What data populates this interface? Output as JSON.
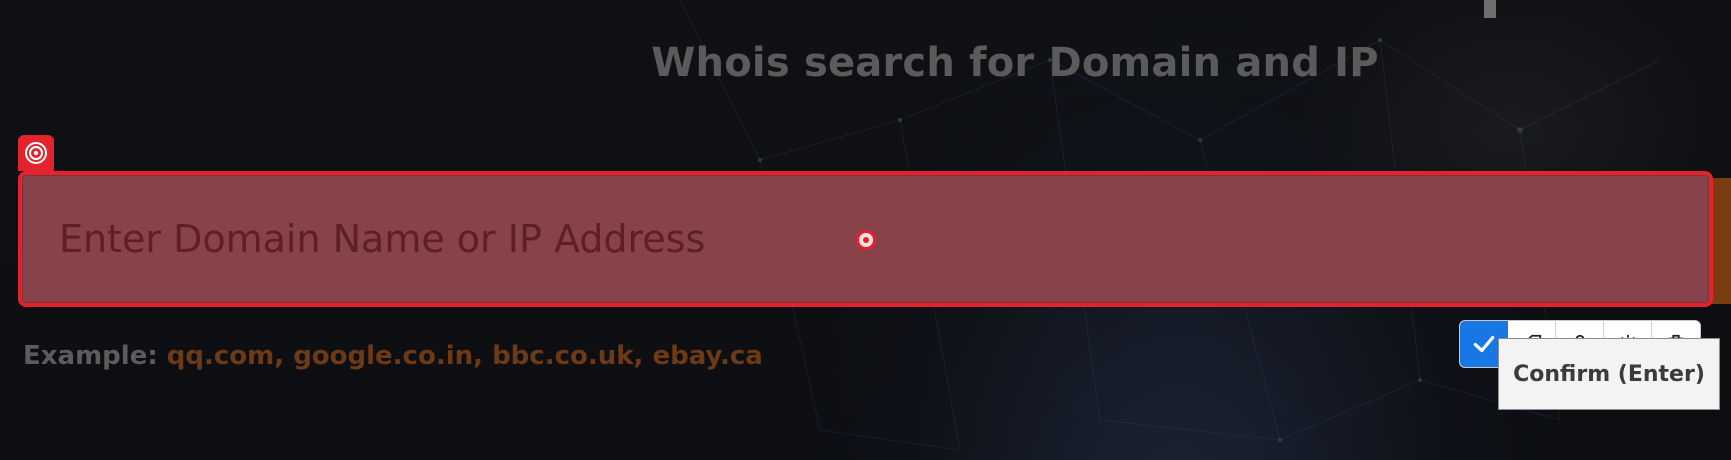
{
  "page": {
    "title": "Whois search for Domain and IP"
  },
  "search": {
    "placeholder": "Enter Domain Name or IP Address",
    "value": ""
  },
  "example": {
    "label": "Example:",
    "values": "qq.com, google.co.in, bbc.co.uk, ebay.ca"
  },
  "annotation_toolbar": {
    "buttons": [
      {
        "icon": "checkmark-icon"
      },
      {
        "icon": "tag-icon"
      },
      {
        "icon": "person-icon"
      },
      {
        "icon": "gear-icon"
      },
      {
        "icon": "trash-icon"
      }
    ],
    "tooltip": "Confirm (Enter)"
  },
  "colors": {
    "highlight": "#e3232e",
    "highlight_fill": "#874349",
    "confirm_button": "#1877e5",
    "example_values": "#6e3915"
  }
}
